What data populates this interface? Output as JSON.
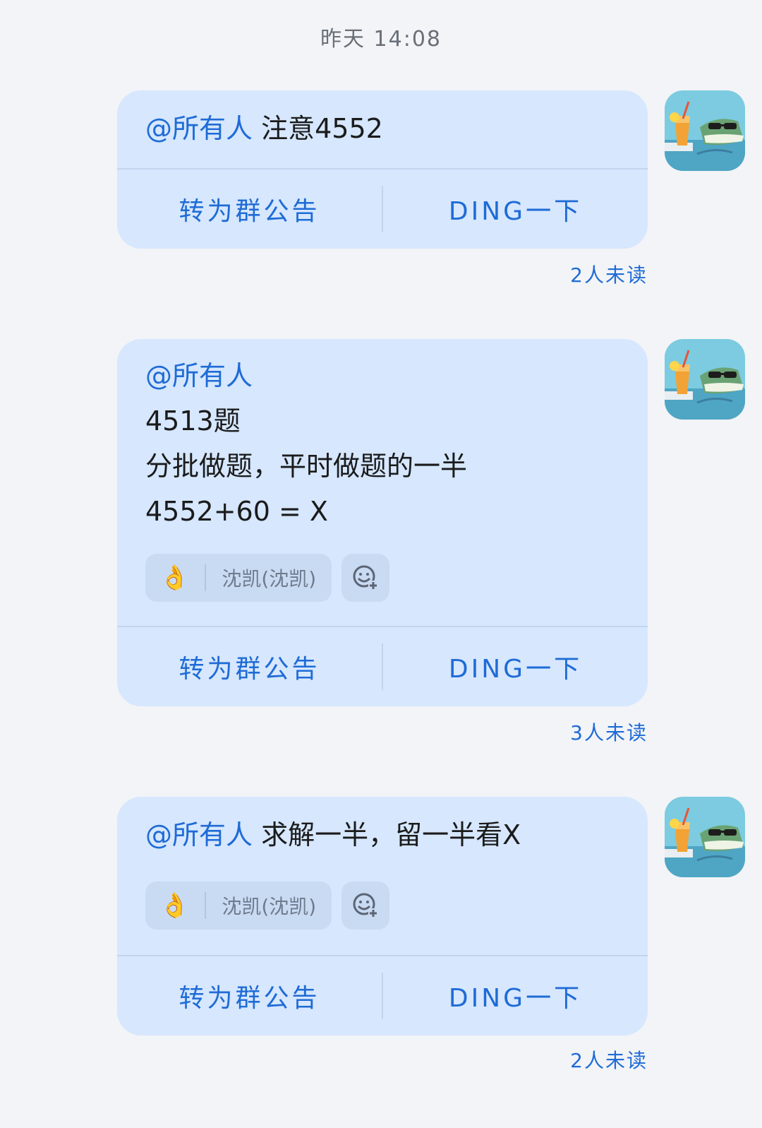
{
  "chat": {
    "timestamp": "昨天 14:08",
    "messages": [
      {
        "mention": "@所有人",
        "lines": [
          "注意4552"
        ],
        "reaction": null,
        "actions": {
          "announce": "转为群公告",
          "ding": "DING一下"
        },
        "read_status": "2人未读",
        "avatar_icon": "crocodile-sunglasses-avatar"
      },
      {
        "mention": "@所有人",
        "lines": [
          "4513题",
          "分批做题，平时做题的一半",
          "4552+60 = X"
        ],
        "reaction": {
          "emoji": "👌",
          "user": "沈凯(沈凯)"
        },
        "actions": {
          "announce": "转为群公告",
          "ding": "DING一下"
        },
        "read_status": "3人未读",
        "avatar_icon": "crocodile-sunglasses-avatar"
      },
      {
        "mention": "@所有人",
        "lines": [
          "求解一半，留一半看X"
        ],
        "reaction": {
          "emoji": "👌",
          "user": "沈凯(沈凯)"
        },
        "actions": {
          "announce": "转为群公告",
          "ding": "DING一下"
        },
        "read_status": "2人未读",
        "avatar_icon": "crocodile-sunglasses-avatar"
      }
    ]
  },
  "colors": {
    "bubble": "#d6e7fe",
    "accent": "#1f6bd6",
    "background": "#f2f4f7"
  }
}
